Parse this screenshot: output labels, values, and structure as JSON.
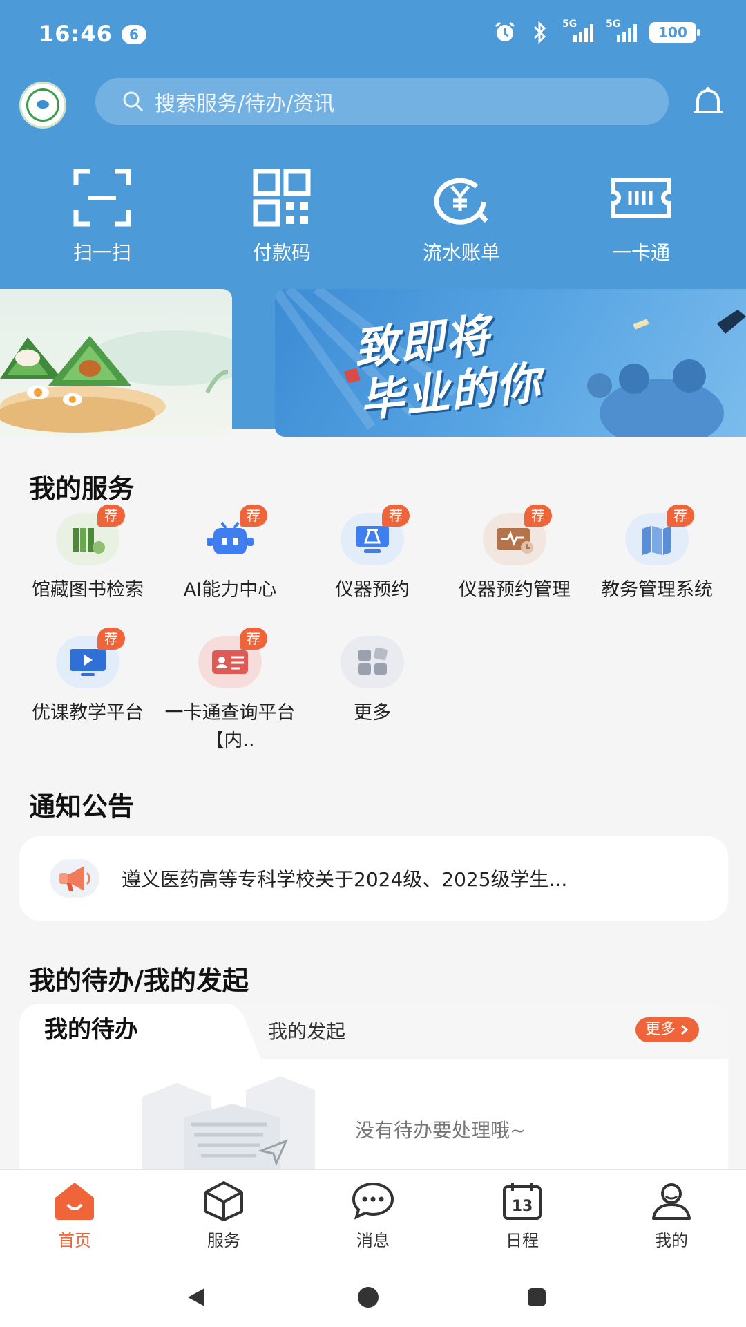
{
  "status": {
    "time": "16:46",
    "notif_count": "6",
    "battery": "100",
    "net1": "5G",
    "net2": "5G"
  },
  "search": {
    "placeholder": "搜索服务/待办/资讯"
  },
  "quick_actions": [
    {
      "label": "扫一扫",
      "icon": "scan-icon"
    },
    {
      "label": "付款码",
      "icon": "qr-code-icon"
    },
    {
      "label": "流水账单",
      "icon": "bill-icon"
    },
    {
      "label": "一卡通",
      "icon": "card-icon"
    }
  ],
  "banner": {
    "title_line1": "致即将",
    "title_line2": "毕业的你"
  },
  "services": {
    "title": "我的服务",
    "badge": "荐",
    "items": [
      {
        "label": "馆藏图书检索",
        "icon": "books-icon",
        "color": "#5b9c4a"
      },
      {
        "label": "AI能力中心",
        "icon": "robot-icon",
        "color": "#3f7ef0"
      },
      {
        "label": "仪器预约",
        "icon": "microscope-icon",
        "color": "#3f7ef0"
      },
      {
        "label": "仪器预约管理",
        "icon": "instrument-manage-icon",
        "color": "#b4734a"
      },
      {
        "label": "教务管理系统",
        "icon": "academic-books-icon",
        "color": "#5a8fd8"
      },
      {
        "label": "优课教学平台",
        "icon": "monitor-icon",
        "color": "#2f6fd6"
      },
      {
        "label": "一卡通查询平台【内..",
        "icon": "id-card-icon",
        "color": "#e05a55"
      },
      {
        "label": "更多",
        "icon": "more-grid-icon",
        "color": "#9aa0ad"
      }
    ]
  },
  "notices": {
    "title": "通知公告",
    "item": "遵义医药高等专科学校关于2024级、2025级学生..."
  },
  "todo": {
    "title": "我的待办/我的发起",
    "tab_active": "我的待办",
    "tab_other": "我的发起",
    "more": "更多",
    "empty": "没有待办要处理哦~"
  },
  "tabbar": [
    {
      "label": "首页",
      "icon": "home-icon",
      "active": true
    },
    {
      "label": "服务",
      "icon": "service-cube-icon",
      "active": false
    },
    {
      "label": "消息",
      "icon": "message-icon",
      "active": false
    },
    {
      "label": "日程",
      "icon": "calendar-icon",
      "active": false,
      "day": "13"
    },
    {
      "label": "我的",
      "icon": "profile-icon",
      "active": false
    }
  ],
  "colors": {
    "header": "#4d9ad8",
    "accent": "#f0643a",
    "background": "#f5f5f6"
  }
}
